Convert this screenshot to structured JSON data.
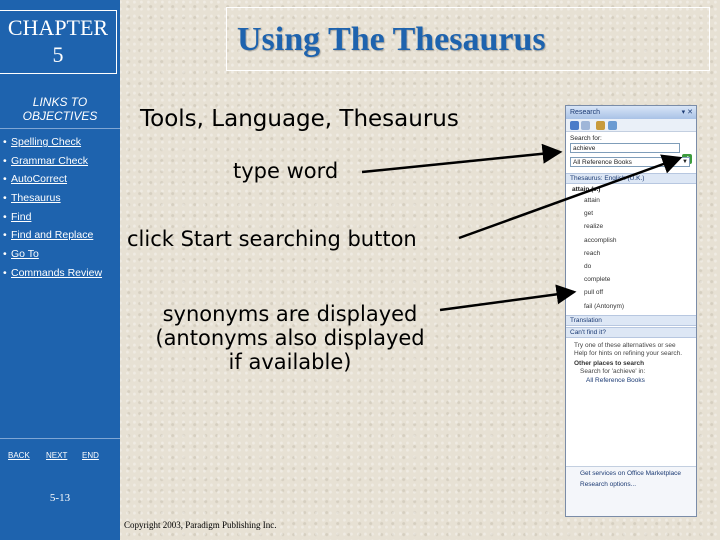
{
  "sidebar": {
    "chapter_line1": "CHAPTER",
    "chapter_line2": "5",
    "links_line1": "LINKS TO",
    "links_line2": "OBJECTIVES",
    "items": [
      {
        "label": "Spelling Check"
      },
      {
        "label": "Grammar Check"
      },
      {
        "label": "AutoCorrect"
      },
      {
        "label": "Thesaurus"
      },
      {
        "label": "Find"
      },
      {
        "label": "Find and Replace"
      },
      {
        "label": "Go To"
      },
      {
        "label": "Commands Review"
      }
    ],
    "bullet": "•",
    "back_label": "BACK",
    "next_label": "NEXT",
    "end_label": "END",
    "slide_number": "5-13"
  },
  "slide": {
    "title": "Using The Thesaurus",
    "menu_path": "Tools, Language, Thesaurus",
    "step_type": "type word",
    "step_click": "click Start searching button",
    "step_syn_line1": "synonyms are displayed",
    "step_syn_line2": "(antonyms also displayed",
    "step_syn_line3": "if available)",
    "copyright": "Copyright 2003, Paradigm Publishing Inc."
  },
  "research_pane": {
    "title": "Research",
    "search_for_label": "Search for:",
    "search_value": "achieve",
    "go_icon": "arrow-right-icon",
    "source_value": "All Reference Books",
    "results_header": "Thesaurus: English (U.K.)",
    "main_entry": "attain (v.)",
    "synonyms": [
      "attain",
      "get",
      "realize",
      "accomplish",
      "reach",
      "do",
      "complete",
      "pull off",
      "fail (Antonym)"
    ],
    "translation_header": "Translation",
    "cant_find_header": "Can't find it?",
    "help_text": "Try one of these alternatives or see Help for hints on refining your search.",
    "other_places_label": "Other places to search",
    "search_for_everything": "Search for 'achieve' in:",
    "all_reference_books": "All Reference Books",
    "footer_services": "Get services on Office Marketplace",
    "footer_options": "Research options..."
  },
  "colors": {
    "sidebar_blue": "#1e63ae",
    "title_blue": "#1e63ae",
    "background": "#e7e1d4"
  }
}
